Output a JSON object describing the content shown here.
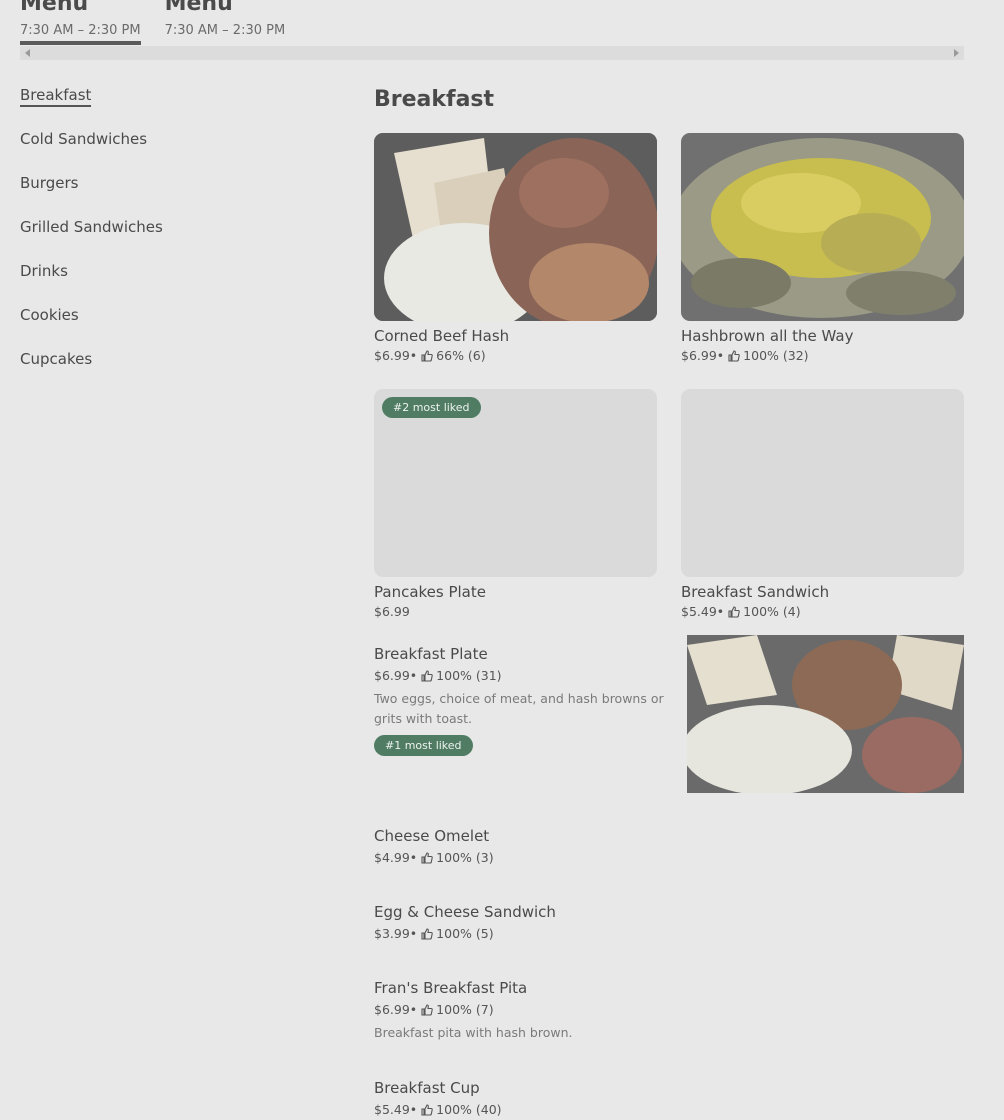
{
  "menus": [
    {
      "title": "Menu",
      "hours": "7:30 AM – 2:30 PM",
      "active": true
    },
    {
      "title": "Menu",
      "hours": "7:30 AM – 2:30 PM",
      "active": false
    }
  ],
  "categories": [
    "Breakfast",
    "Cold Sandwiches",
    "Burgers",
    "Grilled Sandwiches",
    "Drinks",
    "Cookies",
    "Cupcakes"
  ],
  "section_title": "Breakfast",
  "cards": [
    {
      "name": "Corned Beef Hash",
      "price": "$6.99",
      "rating": "66% (6)"
    },
    {
      "name": "Hashbrown all the Way",
      "price": "$6.99",
      "rating": "100% (32)"
    },
    {
      "name": "Pancakes Plate",
      "price": "$6.99",
      "badge": "#2 most liked"
    },
    {
      "name": "Breakfast Sandwich",
      "price": "$5.49",
      "rating": "100% (4)"
    }
  ],
  "list": [
    {
      "name": "Breakfast Plate",
      "price": "$6.99",
      "rating": "100% (31)",
      "desc": "Two eggs, choice of meat, and hash browns or grits with toast.",
      "badge": "#1 most liked"
    },
    {
      "name": "Cheese Omelet",
      "price": "$4.99",
      "rating": "100% (3)"
    },
    {
      "name": "Egg & Cheese Sandwich",
      "price": "$3.99",
      "rating": "100% (5)"
    },
    {
      "name": "Fran's Breakfast Pita",
      "price": "$6.99",
      "rating": "100% (7)",
      "desc": "Breakfast pita with hash brown."
    },
    {
      "name": "Breakfast Cup",
      "price": "$5.49",
      "rating": "100% (40)"
    }
  ],
  "separator": " • ",
  "icons": {
    "rating": "thumbs-up-icon",
    "scroll_left": "left-arrow-icon",
    "scroll_right": "right-arrow-icon"
  },
  "colors": {
    "background": "#e8e8e8",
    "badge": "#4f7c63",
    "text": "#4a4a4a"
  }
}
